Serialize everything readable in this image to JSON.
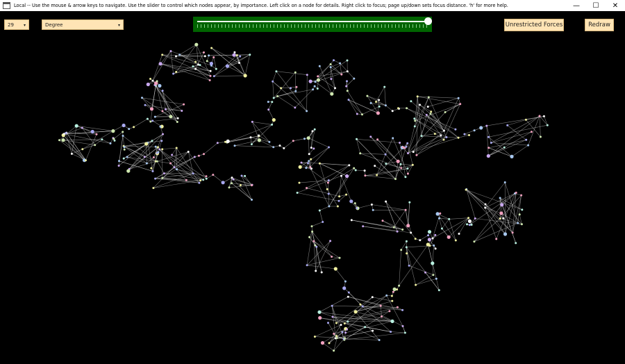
{
  "window": {
    "title": "Local -- Use the mouse & arrow keys to navigate. Use the slider to control which nodes appear, by importance. Left click on a node for details. Right click to focus; page up/down sets focus distance. 'h' for more help.",
    "minimize_glyph": "—",
    "maximize_glyph": "☐",
    "close_glyph": "✕"
  },
  "toolbar": {
    "count_select": "29",
    "measure_select": "Degree",
    "dropdown_arrow": "▾",
    "importance_slider": {
      "value": 1.0
    },
    "forces_button": "Unrestricted Forces",
    "redraw_button": "Redraw"
  },
  "graph": {
    "background": "#000000",
    "edge_color": "#d8d8d8",
    "node_colors": [
      "#cfe8b0",
      "#c9a8f0",
      "#ffffff",
      "#f2a2c0",
      "#a8c8f0",
      "#b8f0e0",
      "#f0f0a0",
      "#a8a8f0"
    ]
  }
}
